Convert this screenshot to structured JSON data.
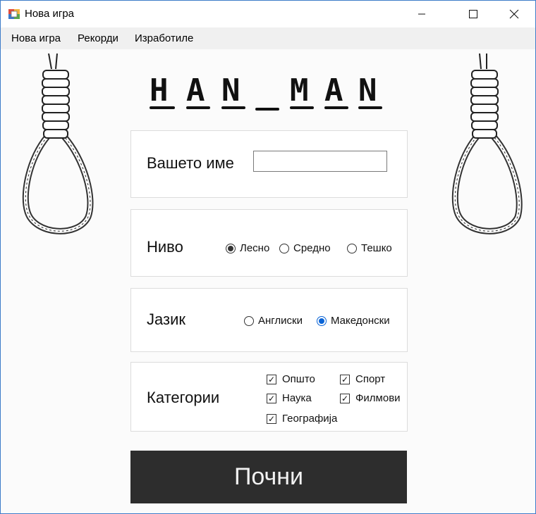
{
  "window": {
    "title": "Нова игра",
    "controls": {
      "minimize": "—",
      "maximize": "☐",
      "close": "✕"
    }
  },
  "menu": {
    "items": [
      "Нова игра",
      "Рекорди",
      "Изработиле"
    ]
  },
  "logo": {
    "text": "HAN_MAN",
    "letters": [
      "H",
      "A",
      "N",
      "M",
      "A",
      "N"
    ]
  },
  "form": {
    "name": {
      "label": "Вашето име",
      "value": ""
    },
    "level": {
      "label": "Ниво",
      "options": [
        {
          "label": "Лесно",
          "checked": true
        },
        {
          "label": "Средно",
          "checked": false
        },
        {
          "label": "Тешко",
          "checked": false
        }
      ]
    },
    "language": {
      "label": "Јазик",
      "options": [
        {
          "label": "Англиски",
          "checked": false
        },
        {
          "label": "Македонски",
          "checked": true
        }
      ]
    },
    "categories": {
      "label": "Категории",
      "options": [
        {
          "label": "Општо",
          "checked": true
        },
        {
          "label": "Спорт",
          "checked": true
        },
        {
          "label": "Наука",
          "checked": true
        },
        {
          "label": "Филмови",
          "checked": true
        },
        {
          "label": "Географија",
          "checked": true
        }
      ]
    }
  },
  "start_button": {
    "label": "Почни"
  },
  "colors": {
    "window_border": "#3d7cc9",
    "button_bg": "#2d2d2d",
    "radio_accent": "#0a64d6"
  }
}
